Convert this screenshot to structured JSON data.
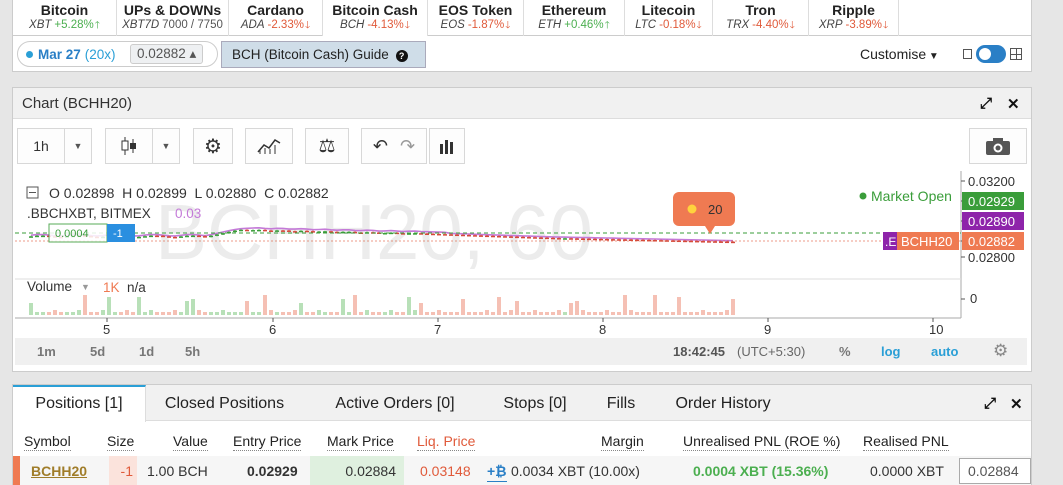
{
  "tickers": [
    {
      "name": "Bitcoin",
      "symbol": "XBT",
      "change": "+5.28%",
      "dir": "up"
    },
    {
      "name": "UPs & DOWNs",
      "symbol": "XBT7D",
      "change": "7000 / 7750",
      "dir": "none"
    },
    {
      "name": "Cardano",
      "symbol": "ADA",
      "change": "-2.33%",
      "dir": "down"
    },
    {
      "name": "Bitcoin Cash",
      "symbol": "BCH",
      "change": "-4.13%",
      "dir": "down"
    },
    {
      "name": "EOS Token",
      "symbol": "EOS",
      "change": "-1.87%",
      "dir": "down"
    },
    {
      "name": "Ethereum",
      "symbol": "ETH",
      "change": "+0.46%",
      "dir": "up"
    },
    {
      "name": "Litecoin",
      "symbol": "LTC",
      "change": "-0.18%",
      "dir": "down"
    },
    {
      "name": "Tron",
      "symbol": "TRX",
      "change": "-4.40%",
      "dir": "down"
    },
    {
      "name": "Ripple",
      "symbol": "XRP",
      "change": "-3.89%",
      "dir": "down"
    }
  ],
  "contract": {
    "date": "Mar 27",
    "leverage": "(20x)",
    "price": "0.02882 ▴"
  },
  "guide_label": "BCH (Bitcoin Cash) Guide",
  "customise_label": "Customise",
  "chart": {
    "title": "Chart (BCHH20)",
    "interval": "1h",
    "ohlc": "O 0.02898  H 0.02899  L 0.02880  C 0.02882",
    "index_label": ".BBCHXBT, BITMEX",
    "index_value": "0.03",
    "index_box": "0.0004",
    "index_box_b": "-1",
    "watermark": "BCHH20, 60",
    "market_status": "Market Open",
    "volume_label": "Volume",
    "volume_value": "1K",
    "volume_extra": "n/a",
    "bubble_count": "20",
    "series_tag": "BCHH20",
    "side_tag": ".E",
    "price_axis": [
      "0.03200",
      "0.02929",
      "0.02890",
      "0.02882",
      "0.02800"
    ],
    "volume_axis": "0",
    "time_axis": [
      "5",
      "6",
      "7",
      "8",
      "9",
      "10"
    ],
    "ranges": [
      "1m",
      "5d",
      "1d",
      "5h"
    ],
    "clock": "18:42:45",
    "timezone": "(UTC+5:30)",
    "percent_label": "%",
    "log_label": "log",
    "auto_label": "auto",
    "colors": {
      "price_line": "#c47ad8",
      "candle_up": "#3a9d3a",
      "candle_down": "#d4483a",
      "volume_up": "#b8e0b8",
      "volume_down": "#f5c0b4"
    }
  },
  "positions": {
    "tabs": [
      "Positions [1]",
      "Closed Positions",
      "Active Orders [0]",
      "Stops [0]",
      "Fills",
      "Order History"
    ],
    "headers": [
      "Symbol",
      "Size",
      "Value",
      "Entry Price",
      "Mark Price",
      "Liq. Price",
      "Margin",
      "Unrealised PNL (ROE %)",
      "Realised PNL"
    ],
    "row": {
      "symbol": "BCHH20",
      "size": "-1",
      "value": "1.00 BCH",
      "entry": "0.02929",
      "mark": "0.02884",
      "liq": "0.03148",
      "margin": "0.0034 XBT (10.00x)",
      "upnl": "0.0004 XBT (15.36%)",
      "rpnl": "0.0000 XBT",
      "close_price": "0.02884"
    }
  }
}
